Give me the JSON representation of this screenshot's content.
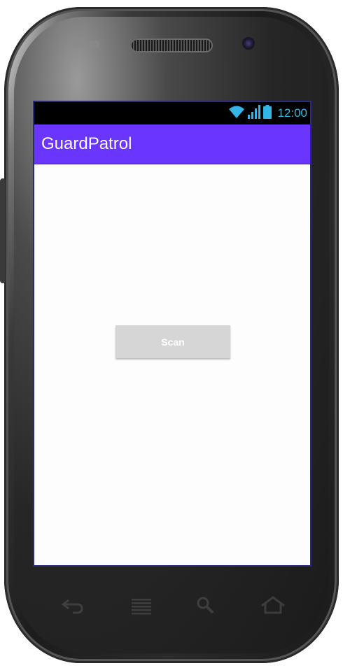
{
  "status_bar": {
    "time": "12:00",
    "accent_color": "#33b5e5",
    "icons": [
      "wifi-icon",
      "signal-icon",
      "battery-icon"
    ]
  },
  "app_bar": {
    "title": "GuardPatrol",
    "color": "#6a35ff"
  },
  "main": {
    "scan_button_label": "Scan"
  },
  "nav_keys": [
    "back-icon",
    "menu-icon",
    "search-icon",
    "home-icon"
  ]
}
